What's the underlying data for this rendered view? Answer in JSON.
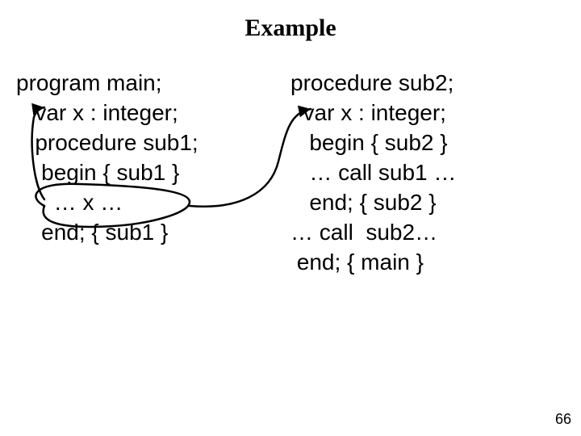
{
  "title": "Example",
  "left": {
    "l1": "program main;",
    "l2": "   var x : integer;",
    "l3": "   procedure sub1;",
    "l4": "    begin { sub1 }",
    "l5": "      … x …",
    "l6": "    end; { sub1 }"
  },
  "right": {
    "l1": "procedure sub2;",
    "l2": "  var x : integer;",
    "l3": "   begin { sub2 }",
    "l4": "   … call sub1 …",
    "l5": "   end; { sub2 }",
    "l6": "… call  sub2…",
    "l7": " end; { main }"
  },
  "page_number": "66"
}
